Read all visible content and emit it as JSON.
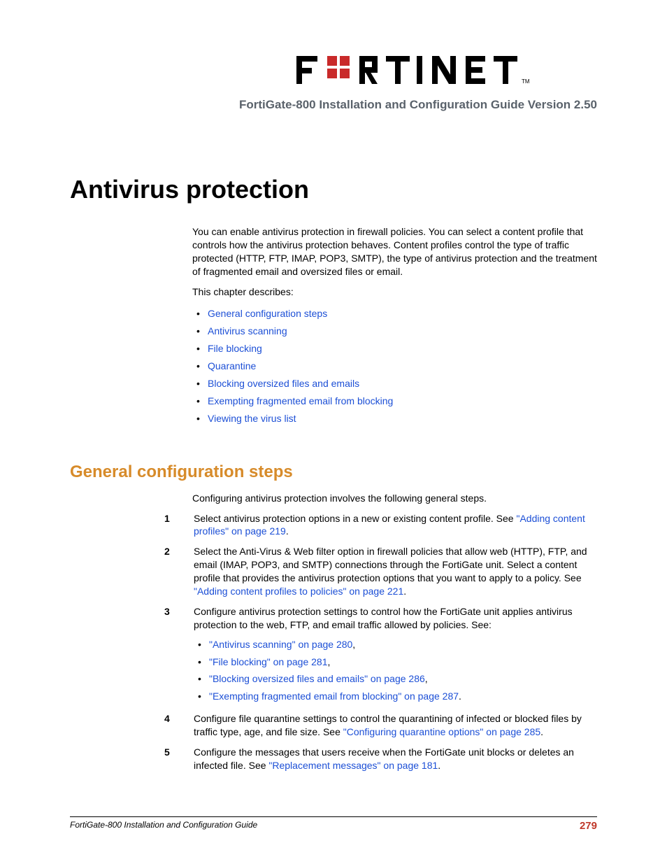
{
  "header": {
    "subtitle": "FortiGate-800 Installation and Configuration Guide Version 2.50"
  },
  "chapter": {
    "title": "Antivirus protection",
    "intro1": "You can enable antivirus protection in firewall policies. You can select a content profile that controls how the antivirus protection behaves. Content profiles control the type of traffic protected (HTTP, FTP, IMAP, POP3, SMTP), the type of antivirus protection and the treatment of fragmented email and oversized files or email.",
    "intro2": "This chapter describes:",
    "toc": [
      "General configuration steps",
      "Antivirus scanning",
      "File blocking",
      "Quarantine",
      "Blocking oversized files and emails",
      "Exempting fragmented email from blocking",
      "Viewing the virus list"
    ]
  },
  "section": {
    "heading": "General configuration steps",
    "intro": "Configuring antivirus protection involves the following general steps.",
    "steps": {
      "n1": "1",
      "s1a": "Select antivirus protection options in a new or existing content profile. See ",
      "s1link": "\"Adding content profiles\" on page 219",
      "s1b": ".",
      "n2": "2",
      "s2a": "Select the Anti-Virus & Web filter option in firewall policies that allow web (HTTP), FTP, and email (IMAP, POP3, and SMTP) connections through the FortiGate unit. Select a content profile that provides the antivirus protection options that you want to apply to a policy. See ",
      "s2link": "\"Adding content profiles to policies\" on page 221",
      "s2b": ".",
      "n3": "3",
      "s3intro": "Configure antivirus protection settings to control how the FortiGate unit applies antivirus protection to the web, FTP, and email traffic allowed by policies. See:",
      "s3_l1": "\"Antivirus scanning\" on page 280",
      "s3_l2": "\"File blocking\" on page 281",
      "s3_l3": "\"Blocking oversized files and emails\" on page 286",
      "s3_l4": "\"Exempting fragmented email from blocking\" on page 287",
      "comma": ",",
      "period": ".",
      "n4": "4",
      "s4a": "Configure file quarantine settings to control the quarantining of infected or blocked files by traffic type, age, and file size. See ",
      "s4link": "\"Configuring quarantine options\" on page 285",
      "s4b": ".",
      "n5": "5",
      "s5a": "Configure the messages that users receive when the FortiGate unit blocks or deletes an infected file. See ",
      "s5link": "\"Replacement messages\" on page 181",
      "s5b": "."
    }
  },
  "footer": {
    "left": "FortiGate-800 Installation and Configuration Guide",
    "page": "279"
  }
}
